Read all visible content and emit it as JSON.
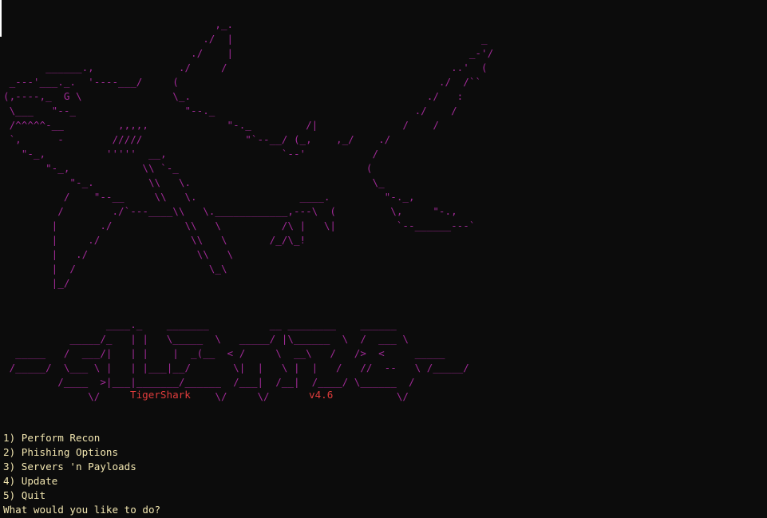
{
  "terminal": {
    "shark_art": "                                   ,_.\n                                 ./  |                                         _\n                               ./    |                                       _-'/\n       ______.,              ./     /                                     ..'  (\n _---'___._.  '----___/     (                                           ./  /``\n(,----,_  G \\               \\_.                                       ./   :\n \\___   \"--_                  \"--._                                 ./    /\n /^^^^^-__         ,,,,,             \"-._         /|              /    /\n `,      -        /////                 \"`--__/ (_,    ,_/    ./\n   \"-_,          '''''  __,                   `--'           /\n       \"-_,            \\\\ `-_                               (\n           \"-_.         \\\\   \\.                              \\_\n          /    \"--__     \\\\   \\.                 ____.         \"-._,\n         /        ./`---____\\\\   \\.____________,---\\  (         \\,     \"-.,\n        |       ./            \\\\   \\          /\\ |   \\|          `--______---`\n        |     ./               \\\\   \\       /_/\\_!\n        |   ./                  \\\\   \\\n        |  /                      \\_\\\n        |_/",
    "banner_art": "                 ____._    _______          __ ________    ______\n           _____/_   | |   \\_____  \\   _____/ |\\______  \\  /  ___ \\\n  _____   /  ___/|   | |    |  _(__  < /     \\  __\\   /   />  <     _____\n /_____/  \\___ \\ |   | |___|__/       \\|  |   \\ |  |   /   //  --   \\ /_____/\n         /____  >|___|_______/______  /___|  /__|  /____/ \\______  /\n              \\/                   \\/     \\/                     \\/",
    "tool_name": "TigerShark",
    "version": "v4.6",
    "menu": [
      "1) Perform Recon",
      "2) Phishing Options",
      "3) Servers 'n Payloads",
      "4) Update",
      "5) Quit"
    ],
    "prompt": "What would you like to do?"
  },
  "colors": {
    "background": "#0c0c0c",
    "ascii_art": "#a02a96",
    "label_red": "#e03c3c",
    "menu_text": "#f2e6b0"
  }
}
